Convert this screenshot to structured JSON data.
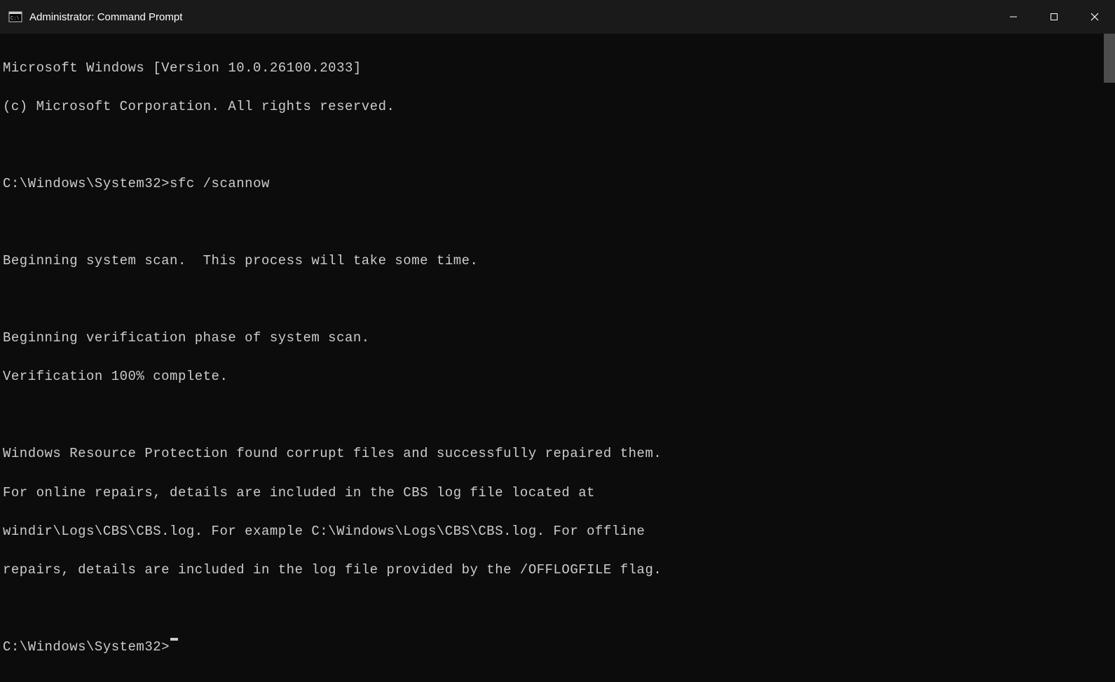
{
  "window": {
    "title": "Administrator: Command Prompt"
  },
  "terminal": {
    "header_line1": "Microsoft Windows [Version 10.0.26100.2033]",
    "header_line2": "(c) Microsoft Corporation. All rights reserved.",
    "prompt1": "C:\\Windows\\System32>",
    "command1": "sfc /scannow",
    "out1": "Beginning system scan.  This process will take some time.",
    "out2": "Beginning verification phase of system scan.",
    "out3": "Verification 100% complete.",
    "out4": "Windows Resource Protection found corrupt files and successfully repaired them.",
    "out5": "For online repairs, details are included in the CBS log file located at",
    "out6": "windir\\Logs\\CBS\\CBS.log. For example C:\\Windows\\Logs\\CBS\\CBS.log. For offline",
    "out7": "repairs, details are included in the log file provided by the /OFFLOGFILE flag.",
    "prompt2": "C:\\Windows\\System32>"
  }
}
